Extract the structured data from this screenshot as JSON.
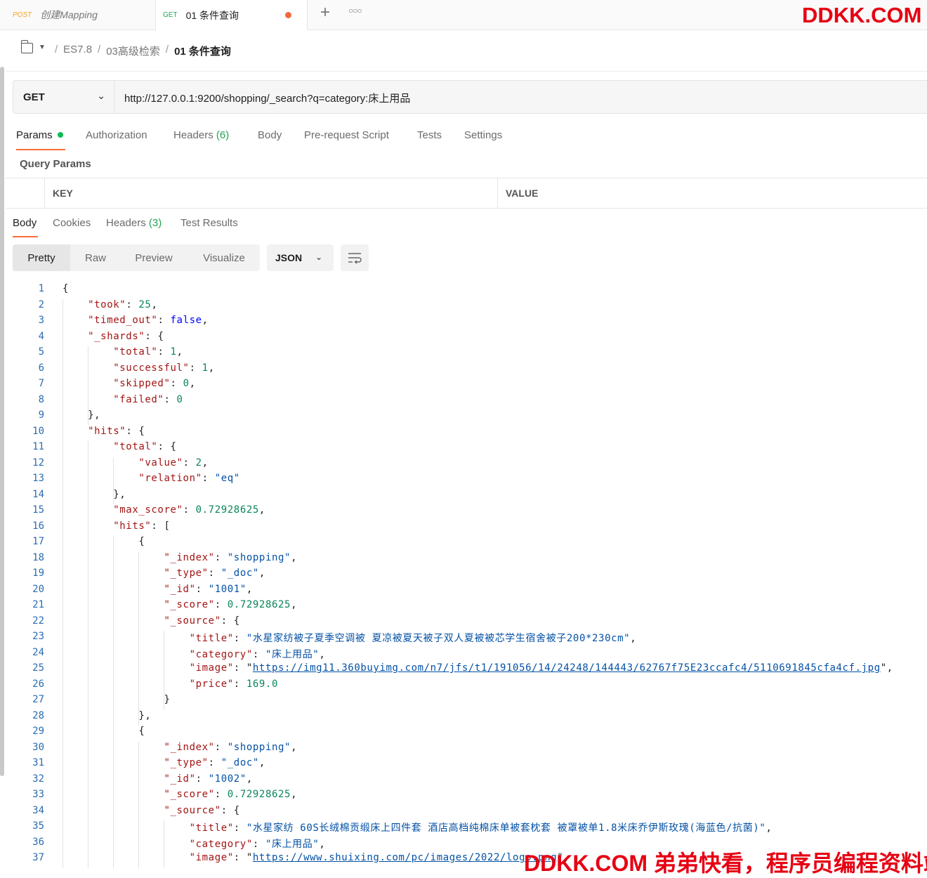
{
  "tabs": [
    {
      "method": "POST",
      "name": "创建Mapping"
    },
    {
      "method": "GET",
      "name": "01 条件查询"
    }
  ],
  "brand": "DDKK.COM",
  "breadcrumb": {
    "items": [
      "ES7.8",
      "03高级检索"
    ],
    "current": "01 条件查询"
  },
  "request": {
    "method": "GET",
    "url": "http://127.0.0.1:9200/shopping/_search?q=category:床上用品"
  },
  "request_tabs": {
    "params": "Params",
    "authorization": "Authorization",
    "headers": "Headers",
    "headers_count": "(6)",
    "body": "Body",
    "prerequest": "Pre-request Script",
    "tests": "Tests",
    "settings": "Settings"
  },
  "query_params": {
    "title": "Query Params",
    "key_header": "KEY",
    "value_header": "VALUE"
  },
  "response_tabs": {
    "body": "Body",
    "cookies": "Cookies",
    "headers": "Headers",
    "headers_count": "(3)",
    "test_results": "Test Results"
  },
  "view": {
    "pretty": "Pretty",
    "raw": "Raw",
    "preview": "Preview",
    "visualize": "Visualize",
    "format": "JSON"
  },
  "watermark": "DDKK.COM 弟弟快看，程序员编程资料站",
  "code_lines": [
    "{",
    "    \"took\": 25,",
    "    \"timed_out\": false,",
    "    \"_shards\": {",
    "        \"total\": 1,",
    "        \"successful\": 1,",
    "        \"skipped\": 0,",
    "        \"failed\": 0",
    "    },",
    "    \"hits\": {",
    "        \"total\": {",
    "            \"value\": 2,",
    "            \"relation\": \"eq\"",
    "        },",
    "        \"max_score\": 0.72928625,",
    "        \"hits\": [",
    "            {",
    "                \"_index\": \"shopping\",",
    "                \"_type\": \"_doc\",",
    "                \"_id\": \"1001\",",
    "                \"_score\": 0.72928625,",
    "                \"_source\": {",
    "                    \"title\": \"水星家纺被子夏季空调被 夏凉被夏天被子双人夏被被芯学生宿舍被子200*230cm\",",
    "                    \"category\": \"床上用品\",",
    "                    \"image\": \"https://img11.360buyimg.com/n7/jfs/t1/191056/14/24248/144443/62767f75E23ccafc4/5110691845cfa4cf.jpg\",",
    "                    \"price\": 169.0",
    "                }",
    "            },",
    "            {",
    "                \"_index\": \"shopping\",",
    "                \"_type\": \"_doc\",",
    "                \"_id\": \"1002\",",
    "                \"_score\": 0.72928625,",
    "                \"_source\": {",
    "                    \"title\": \"水星家纺 60S长绒棉贡缎床上四件套 酒店高档纯棉床单被套枕套 被罩被单1.8米床乔伊斯玫瑰(海蓝色/抗菌)\",",
    "                    \"category\": \"床上用品\",",
    "                    \"image\": \"https://www.shuixing.com/pc/images/2022/logo.png\","
  ]
}
